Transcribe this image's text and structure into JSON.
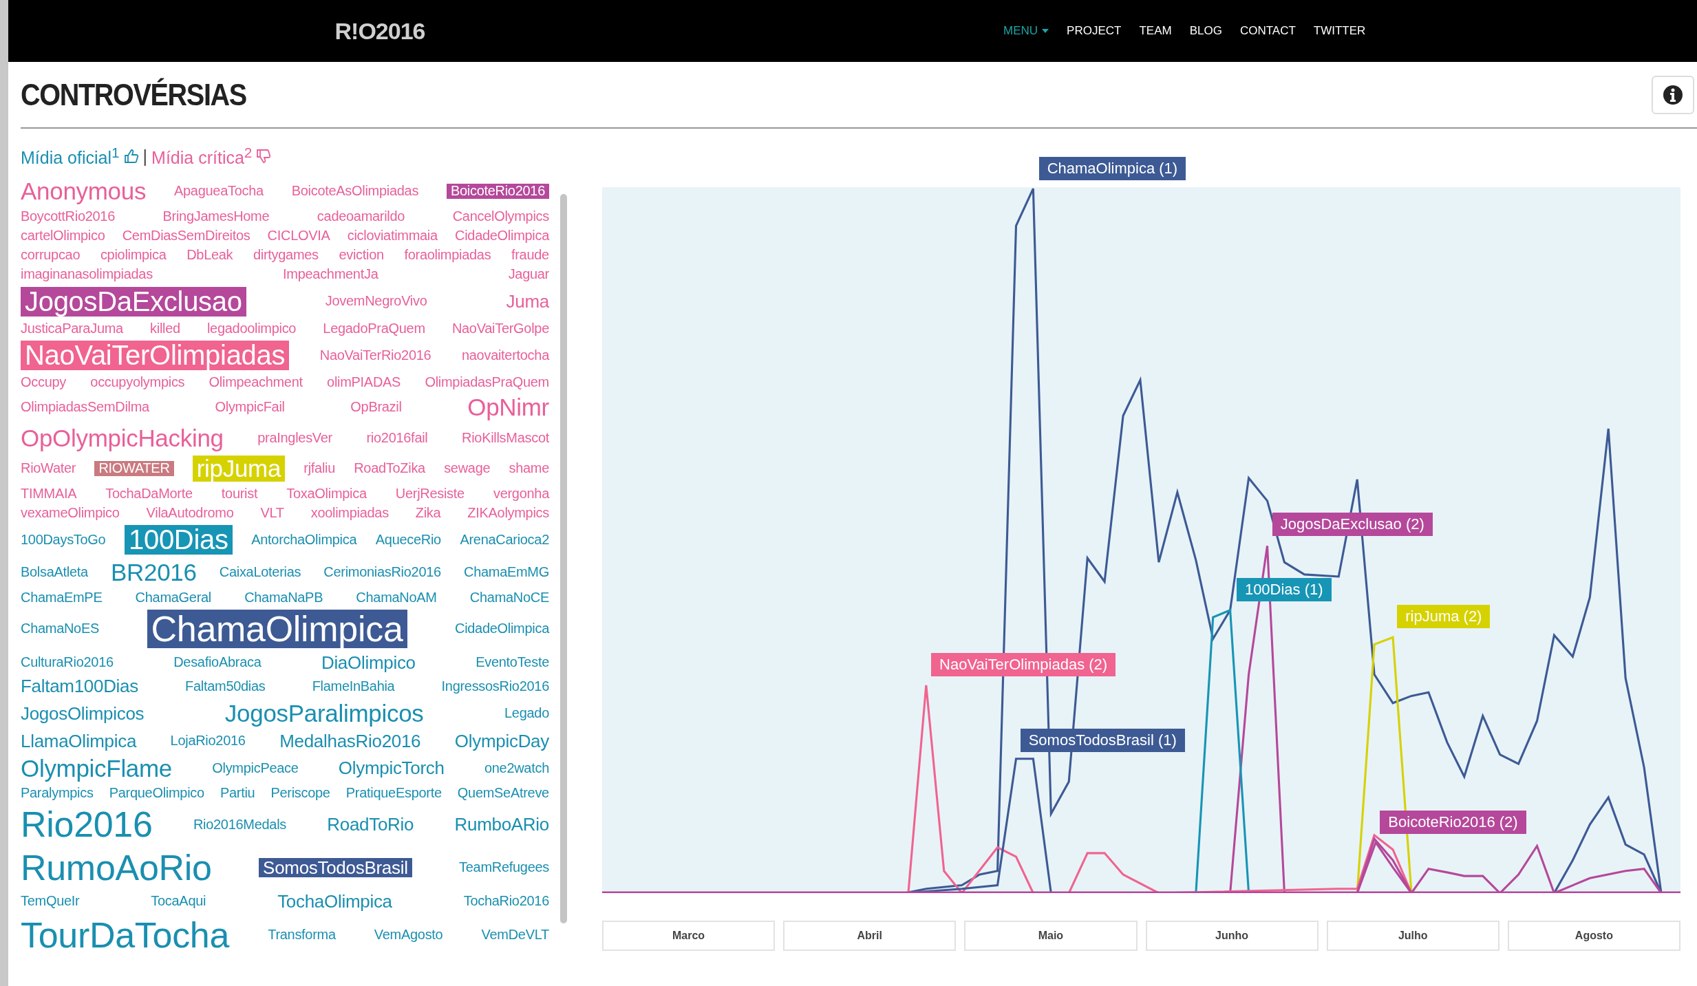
{
  "header": {
    "logo": "R!O2016",
    "nav": [
      {
        "label": "MENU",
        "selected": true,
        "has_menu": true
      },
      {
        "label": "PROJECT",
        "selected": false,
        "has_menu": false
      },
      {
        "label": "TEAM",
        "selected": false,
        "has_menu": false
      },
      {
        "label": "BLOG",
        "selected": false,
        "has_menu": false
      },
      {
        "label": "CONTACT",
        "selected": false,
        "has_menu": false
      },
      {
        "label": "TWITTER",
        "selected": false,
        "has_menu": false
      }
    ]
  },
  "title": "CONTROVÉRSIAS",
  "legend": {
    "official": "Mídia oficial$^{1}$",
    "separator": "|",
    "critical": "Mídia crítica$^{2}$"
  },
  "cloud": {
    "groups": [
      {
        "kind": "critical",
        "rows": [
          [
            {
              "text": "Anonymous",
              "kind": "large"
            },
            {
              "text": "ApagueaTocha",
              "kind": "small"
            },
            {
              "text": "BoicoteAsOlimpiadas",
              "kind": "small"
            },
            {
              "text": "BoicoteRio2016",
              "kind": "small",
              "color": "#b5489a"
            }
          ],
          [
            {
              "text": "BoycottRio2016",
              "kind": "small"
            },
            {
              "text": "BringJamesHome",
              "kind": "small"
            },
            {
              "text": "cadeoamarildo",
              "kind": "small"
            },
            {
              "text": "CancelOlympics",
              "kind": "small"
            }
          ],
          [
            {
              "text": "cartelOlimpico",
              "kind": "small"
            },
            {
              "text": "CemDiasSemDireitos",
              "kind": "small"
            },
            {
              "text": "CICLOVIA",
              "kind": "small"
            },
            {
              "text": "cicloviatimmaia",
              "kind": "small"
            },
            {
              "text": "CidadeOlimpica",
              "kind": "small"
            }
          ],
          [
            {
              "text": "corrupcao",
              "kind": "small"
            },
            {
              "text": "cpiolimpica",
              "kind": "small"
            },
            {
              "text": "DbLeak",
              "kind": "small"
            },
            {
              "text": "dirtygames",
              "kind": "small"
            },
            {
              "text": "eviction",
              "kind": "small"
            },
            {
              "text": "foraolimpiadas",
              "kind": "small"
            },
            {
              "text": "fraude",
              "kind": "small"
            }
          ],
          [
            {
              "text": "imaginanasolimpiadas",
              "kind": "small"
            },
            {
              "text": "ImpeachmentJa",
              "kind": "small"
            },
            {
              "text": "Jaguar",
              "kind": "small"
            }
          ],
          [
            {
              "text": "JogosDaExclusao",
              "kind": "xlarge",
              "color": "#b5489a"
            },
            {
              "text": "JovemNegroVivo",
              "kind": "small"
            },
            {
              "text": "Juma",
              "kind": "medium"
            }
          ],
          [
            {
              "text": "JusticaParaJuma",
              "kind": "small"
            },
            {
              "text": "killed",
              "kind": "small"
            },
            {
              "text": "legadoolimpico",
              "kind": "small"
            },
            {
              "text": "LegadoPraQuem",
              "kind": "small"
            },
            {
              "text": "NaoVaiTerGolpe",
              "kind": "small"
            }
          ],
          [
            {
              "text": "NaoVaiTerOlimpiadas",
              "kind": "xlarge",
              "color": "#f0648f"
            },
            {
              "text": "NaoVaiTerRio2016",
              "kind": "small"
            },
            {
              "text": "naovaitertocha",
              "kind": "small"
            }
          ],
          [
            {
              "text": "Occupy",
              "kind": "small"
            },
            {
              "text": "occupyolympics",
              "kind": "small"
            },
            {
              "text": "Olimpeachment",
              "kind": "small"
            },
            {
              "text": "olimPIADAS",
              "kind": "small"
            },
            {
              "text": "OlimpiadasPraQuem",
              "kind": "small"
            }
          ],
          [
            {
              "text": "OlimpiadasSemDilma",
              "kind": "small"
            },
            {
              "text": "OlympicFail",
              "kind": "small"
            },
            {
              "text": "OpBrazil",
              "kind": "small"
            },
            {
              "text": "OpNimr",
              "kind": "large"
            }
          ],
          [
            {
              "text": "OpOlympicHacking",
              "kind": "large"
            },
            {
              "text": "praInglesVer",
              "kind": "small"
            },
            {
              "text": "rio2016fail",
              "kind": "small"
            },
            {
              "text": "RioKillsMascot",
              "kind": "small"
            }
          ],
          [
            {
              "text": "RioWater",
              "kind": "small"
            },
            {
              "text": "RIOWATER",
              "kind": "small",
              "color": "#c97a80"
            },
            {
              "text": "ripJuma",
              "kind": "large",
              "color": "#d6d200"
            },
            {
              "text": "rjfaliu",
              "kind": "small"
            },
            {
              "text": "RoadToZika",
              "kind": "small"
            },
            {
              "text": "sewage",
              "kind": "small"
            },
            {
              "text": "shame",
              "kind": "small"
            }
          ],
          [
            {
              "text": "TIMMAIA",
              "kind": "small"
            },
            {
              "text": "TochaDaMorte",
              "kind": "small"
            },
            {
              "text": "tourist",
              "kind": "small"
            },
            {
              "text": "ToxaOlimpica",
              "kind": "small"
            },
            {
              "text": "UerjResiste",
              "kind": "small"
            },
            {
              "text": "vergonha",
              "kind": "small"
            }
          ],
          [
            {
              "text": "vexameOlimpico",
              "kind": "small"
            },
            {
              "text": "VilaAutodromo",
              "kind": "small"
            },
            {
              "text": "VLT",
              "kind": "small"
            },
            {
              "text": "xoolimpiadas",
              "kind": "small"
            },
            {
              "text": "Zika",
              "kind": "small"
            },
            {
              "text": "ZIKAolympics",
              "kind": "small"
            }
          ]
        ]
      },
      {
        "kind": "official",
        "rows": [
          [
            {
              "text": "100DaysToGo",
              "kind": "small"
            },
            {
              "text": "100Dias",
              "kind": "xlarge",
              "color": "#1795b5"
            },
            {
              "text": "AntorchaOlimpica",
              "kind": "small"
            },
            {
              "text": "AqueceRio",
              "kind": "small"
            },
            {
              "text": "ArenaCarioca2",
              "kind": "small"
            }
          ],
          [
            {
              "text": "BolsaAtleta",
              "kind": "small"
            },
            {
              "text": "BR2016",
              "kind": "large"
            },
            {
              "text": "CaixaLoterias",
              "kind": "small"
            },
            {
              "text": "CerimoniasRio2016",
              "kind": "small"
            },
            {
              "text": "ChamaEmMG",
              "kind": "small"
            }
          ],
          [
            {
              "text": "ChamaEmPE",
              "kind": "small"
            },
            {
              "text": "ChamaGeral",
              "kind": "small"
            },
            {
              "text": "ChamaNaPB",
              "kind": "small"
            },
            {
              "text": "ChamaNoAM",
              "kind": "small"
            },
            {
              "text": "ChamaNoCE",
              "kind": "small"
            }
          ],
          [
            {
              "text": "ChamaNoES",
              "kind": "small"
            },
            {
              "text": "ChamaOlimpica",
              "kind": "huge",
              "color": "#3d5a94"
            },
            {
              "text": "CidadeOlimpica",
              "kind": "small"
            }
          ],
          [
            {
              "text": "CulturaRio2016",
              "kind": "small"
            },
            {
              "text": "DesafioAbraca",
              "kind": "small"
            },
            {
              "text": "DiaOlimpico",
              "kind": "medium"
            },
            {
              "text": "EventoTeste",
              "kind": "small"
            }
          ],
          [
            {
              "text": "Faltam100Dias",
              "kind": "medium"
            },
            {
              "text": "Faltam50dias",
              "kind": "small"
            },
            {
              "text": "FlameInBahia",
              "kind": "small"
            },
            {
              "text": "IngressosRio2016",
              "kind": "small"
            }
          ],
          [
            {
              "text": "JogosOlimpicos",
              "kind": "medium"
            },
            {
              "text": "JogosParalimpicos",
              "kind": "large"
            },
            {
              "text": "Legado",
              "kind": "small"
            }
          ],
          [
            {
              "text": "LlamaOlimpica",
              "kind": "medium"
            },
            {
              "text": "LojaRio2016",
              "kind": "small"
            },
            {
              "text": "MedalhasRio2016",
              "kind": "medium"
            },
            {
              "text": "OlympicDay",
              "kind": "medium"
            }
          ],
          [
            {
              "text": "OlympicFlame",
              "kind": "large"
            },
            {
              "text": "OlympicPeace",
              "kind": "small"
            },
            {
              "text": "OlympicTorch",
              "kind": "medium"
            },
            {
              "text": "one2watch",
              "kind": "small"
            }
          ],
          [
            {
              "text": "Paralympics",
              "kind": "small"
            },
            {
              "text": "ParqueOlimpico",
              "kind": "small"
            },
            {
              "text": "Partiu",
              "kind": "small"
            },
            {
              "text": "Periscope",
              "kind": "small"
            },
            {
              "text": "PratiqueEsporte",
              "kind": "small"
            },
            {
              "text": "QuemSeAtreve",
              "kind": "small"
            }
          ],
          [
            {
              "text": "Rio2016",
              "kind": "huge"
            },
            {
              "text": "Rio2016Medals",
              "kind": "small"
            },
            {
              "text": "RoadToRio",
              "kind": "medium"
            },
            {
              "text": "RumboARio",
              "kind": "medium"
            }
          ],
          [
            {
              "text": "RumoAoRio",
              "kind": "huge"
            },
            {
              "text": "SomosTodosBrasil",
              "kind": "medium",
              "color": "#3d5a94"
            },
            {
              "text": "TeamRefugees",
              "kind": "small"
            }
          ],
          [
            {
              "text": "TemQueIr",
              "kind": "small"
            },
            {
              "text": "TocaAqui",
              "kind": "small"
            },
            {
              "text": "TochaOlimpica",
              "kind": "medium"
            },
            {
              "text": "TochaRio2016",
              "kind": "small"
            }
          ],
          [
            {
              "text": "TourDaTocha",
              "kind": "huge"
            },
            {
              "text": "Transforma",
              "kind": "small"
            },
            {
              "text": "VemAgosto",
              "kind": "small"
            },
            {
              "text": "VemDeVLT",
              "kind": "small"
            }
          ]
        ]
      }
    ]
  },
  "chart": {
    "labels": [
      {
        "text": "ChamaOlimpica (1)",
        "color": "#3d5a94"
      },
      {
        "text": "JogosDaExclusao (2)",
        "color": "#b5489a"
      },
      {
        "text": "100Dias (1)",
        "color": "#1795b5"
      },
      {
        "text": "ripJuma (2)",
        "color": "#d6d200"
      },
      {
        "text": "NaoVaiTerOlimpiadas (2)",
        "color": "#f0648f"
      },
      {
        "text": "SomosTodosBrasil (1)",
        "color": "#3d5a94"
      },
      {
        "text": "BoicoteRio2016 (2)",
        "color": "#b5489a"
      }
    ],
    "months": [
      "Marco",
      "Abril",
      "Maio",
      "Junho",
      "Julho",
      "Agosto"
    ]
  }
}
